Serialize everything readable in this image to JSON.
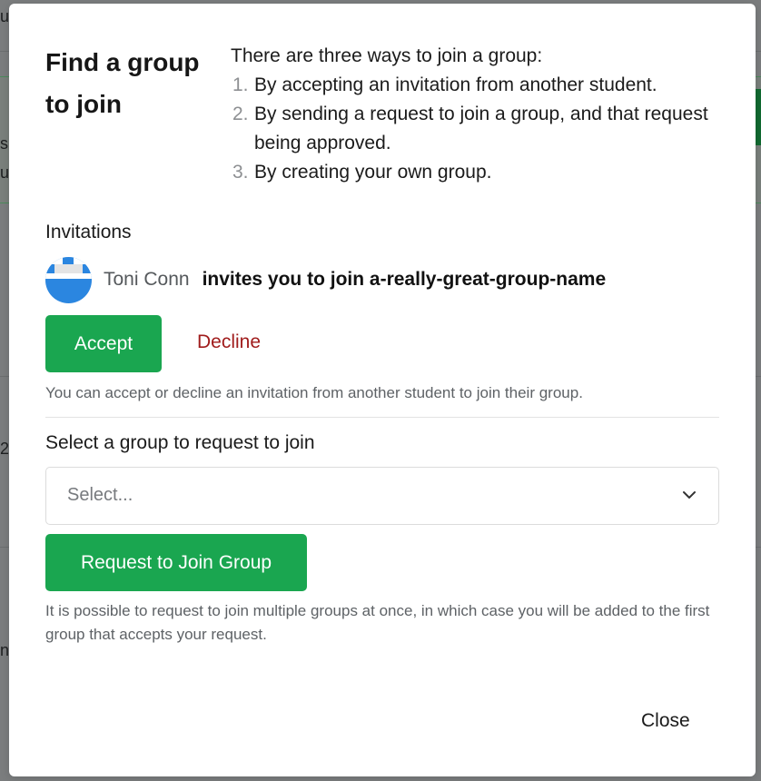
{
  "background": {
    "fragments": [
      "u",
      "si",
      "u",
      "2",
      "n"
    ]
  },
  "modal": {
    "title": "Find a group to join",
    "ways_intro": "There are three ways to join a group:",
    "ways": [
      {
        "num": "1.",
        "text": "By accepting an invitation from another student."
      },
      {
        "num": "2.",
        "text": "By sending a request to join a group, and that request being approved."
      },
      {
        "num": "3.",
        "text": "By creating your own group."
      }
    ],
    "invitations": {
      "heading": "Invitations",
      "inviter": "Toni Conn",
      "invite_text": "invites you to join a-really-great-group-name",
      "accept_label": "Accept",
      "decline_label": "Decline",
      "help": "You can accept or decline an invitation from another student to join their group."
    },
    "request": {
      "heading": "Select a group to request to join",
      "select_placeholder": "Select...",
      "button_label": "Request to Join Group",
      "help": "It is possible to request to join multiple groups at once, in which case you will be added to the first group that accepts your request."
    },
    "close_label": "Close"
  },
  "colors": {
    "accent_green": "#1aa650",
    "decline_red": "#a01c1c",
    "avatar_blue": "#2b86e0"
  }
}
